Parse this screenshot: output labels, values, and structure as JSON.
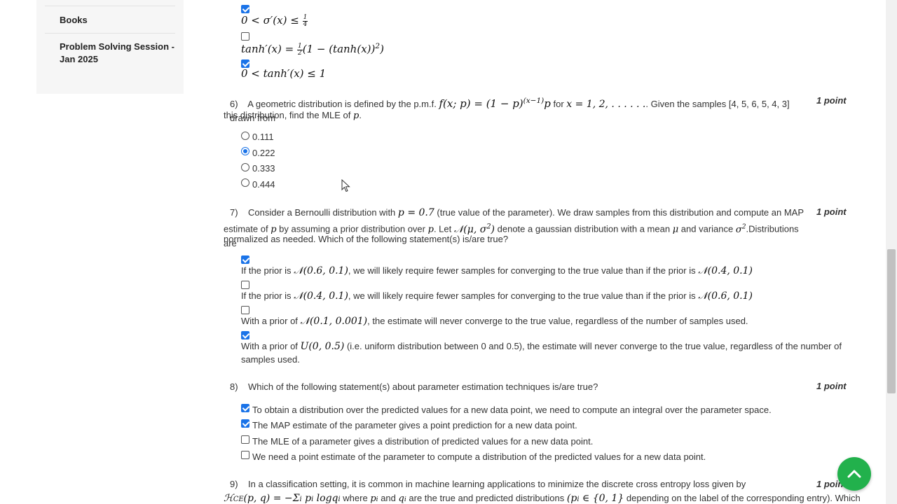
{
  "sidebar": {
    "items": [
      {
        "label": "Books"
      },
      {
        "label": "Problem Solving Session - Jan 2025"
      }
    ]
  },
  "q5_tail": {
    "opt2_math": "0 < σ'(x) ≤ 1/4",
    "opt3_math": "tanh'(x) = 1/2(1 − (tanh(x))^2)",
    "opt4_math": "0 < tanh'(x) ≤ 1",
    "checked": [
      true,
      false,
      true
    ]
  },
  "q6": {
    "number": "6)",
    "text_a": "A geometric distribution is defined by the p.m.f.",
    "text_b": "for",
    "text_c": ". Given the samples [4, 5, 6, 5, 4, 3] drawn from",
    "text_d": "this distribution, find the MLE of",
    "points": "1 point",
    "options": [
      "0.111",
      "0.222",
      "0.333",
      "0.444"
    ],
    "selected": 1
  },
  "q7": {
    "number": "7)",
    "line1_a": "Consider a Bernoulli distribution with",
    "line1_b": "(true value of the parameter). We draw samples from this distribution and compute an MAP",
    "line2_a": "estimate of",
    "line2_b": "by assuming a prior distribution over",
    "line2_c": ". Let",
    "line2_d": "denote a gaussian distribution with a mean",
    "line2_e": "and variance",
    "line2_f": ".Distributions are",
    "line3": "normalized as needed. Which of the following statement(s) is/are true?",
    "points": "1 point",
    "opt1_a": "If the prior is",
    "opt1_b": ", we will likely require fewer samples for converging to the true value than if the prior is",
    "opt2_a": "If the prior is",
    "opt2_b": ", we will likely require fewer samples for converging to the true value than if the prior is",
    "opt3_a": "With a prior of",
    "opt3_b": ", the estimate will never converge to the true value, regardless of the number of samples used.",
    "opt4_a": "With a prior of",
    "opt4_b": "(i.e. uniform distribution between 0 and 0.5), the estimate will never converge to the true value, regardless of the number of",
    "opt4_c": "samples used.",
    "checked": [
      true,
      false,
      false,
      true
    ]
  },
  "q8": {
    "number": "8)",
    "text": "Which of the following statement(s) about parameter estimation techniques is/are true?",
    "points": "1 point",
    "options": [
      "To obtain a distribution over the predicted values for a new data point, we need to compute an integral over the parameter space.",
      "The MAP estimate of the parameter gives a point prediction for a new data point.",
      "The MLE of a parameter gives a distribution of predicted values for a new data point.",
      "We need a point estimate of the parameter to compute a distribution of the predicted values for a new data point."
    ],
    "checked": [
      true,
      true,
      false,
      false
    ]
  },
  "q9": {
    "number": "9)",
    "text_a": "In a classification setting, it is common in machine learning applications to minimize the discrete cross entropy loss given by",
    "text_b": "where",
    "text_c": "and",
    "text_d": "are the true and predicted distributions",
    "text_e": "depending on the label of the corresponding entry). Which",
    "points": "1 point"
  },
  "colors": {
    "accent": "#1a73e8",
    "fab": "#22b14c",
    "sidebar_bg": "#f6f6f6"
  },
  "icons": {
    "fab": "chevron-up-icon",
    "cursor": "mouse-pointer-icon"
  }
}
